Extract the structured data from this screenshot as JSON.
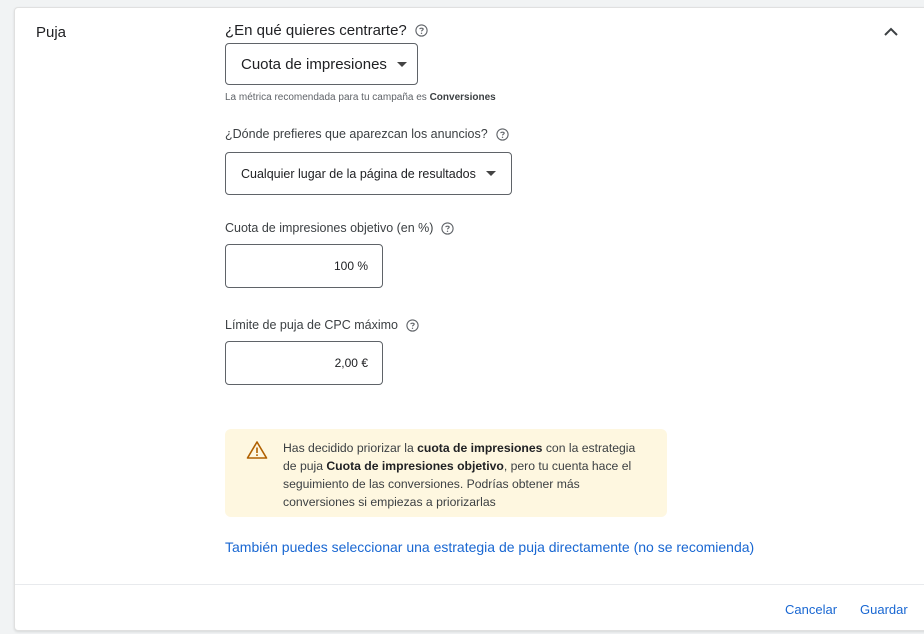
{
  "section": {
    "title": "Puja"
  },
  "focus": {
    "label": "¿En qué quieres centrarte?",
    "selected": "Cuota de impresiones",
    "hint_prefix": "La métrica recomendada para tu campaña es",
    "hint_metric": "Conversiones"
  },
  "placement": {
    "label": "¿Dónde prefieres que aparezcan los anuncios?",
    "selected": "Cualquier lugar de la página de resultados"
  },
  "target_share": {
    "label": "Cuota de impresiones objetivo (en %)",
    "value": "100 %"
  },
  "max_cpc": {
    "label": "Límite de puja de CPC máximo",
    "value": "2,00 €"
  },
  "warning": {
    "part1": "Has decidido priorizar la",
    "bold1": "cuota de impresiones",
    "part2": "con la estrategia de puja",
    "bold2": "Cuota de impresiones objetivo",
    "part3": ", pero tu cuenta hace el seguimiento de las conversiones. Podrías obtener más conversiones si empiezas a priorizarlas"
  },
  "link": {
    "text": "También puedes seleccionar una estrategia de puja directamente (no se recomienda)"
  },
  "footer": {
    "cancel": "Cancelar",
    "save": "Guardar"
  },
  "colors": {
    "accent": "#1967d2",
    "warning_bg": "#fef7e0",
    "warning_icon": "#b06000"
  },
  "icons": {
    "collapse": "chevron-up-icon",
    "help": "help-circle-icon",
    "warning": "warning-triangle-icon",
    "dropdown": "caret-down-icon"
  }
}
